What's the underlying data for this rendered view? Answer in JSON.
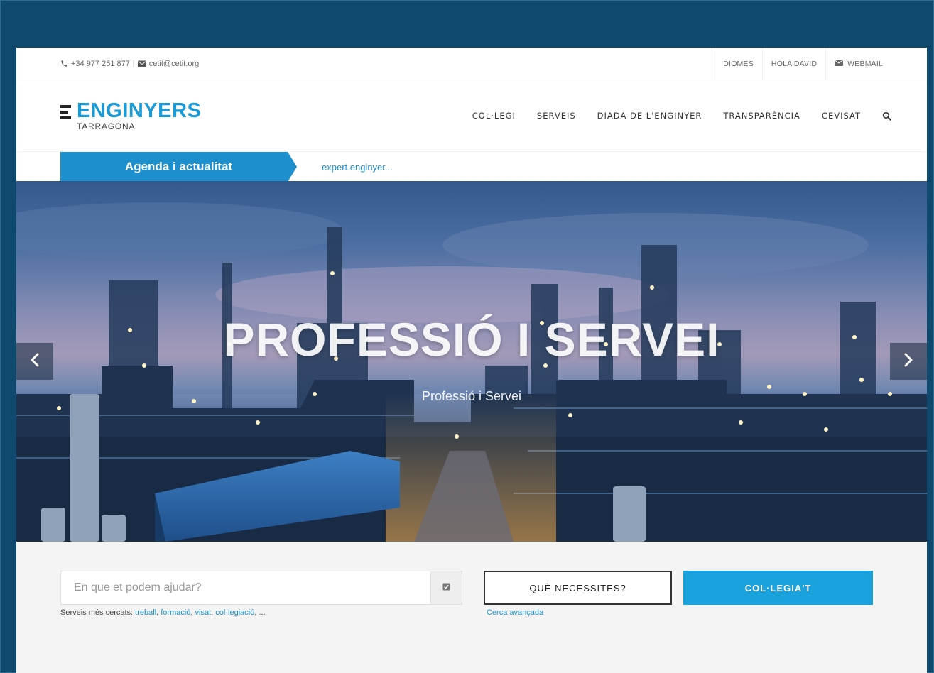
{
  "topbar": {
    "phone": "+34 977 251 877",
    "separator": "|",
    "email": "cetit@cetit.org",
    "utility_links": [
      "IDIOMES",
      "HOLA DAVID",
      "WEBMAIL"
    ]
  },
  "logo": {
    "name": "ENGINYERS",
    "sub": "TARRAGONA"
  },
  "nav": {
    "items": [
      "COL·LEGI",
      "SERVEIS",
      "DIADA DE L'ENGINYER",
      "TRANSPARÈNCIA",
      "CEVISAT"
    ]
  },
  "ribbon": {
    "tab_label": "Agenda i actualitat",
    "ticker_text": "expert.enginyer..."
  },
  "hero": {
    "title": "PROFESSIÓ I SERVEI",
    "subtitle": "Professió i Servei"
  },
  "search": {
    "placeholder": "En que et podem ajudar?",
    "popular_label": "Serveis més cercats: ",
    "popular_links": [
      "treball",
      "formació",
      "visat",
      "col·legiació",
      "..."
    ],
    "need_button": "QUÈ NECESSITES?",
    "advanced_link": "Cerca avançada",
    "join_button": "COL·LEGIA'T"
  },
  "colors": {
    "frame_background": "#0f4a6e",
    "brand_blue": "#1a9ad6",
    "ribbon_blue": "#1e8fcd",
    "join_button": "#1aa2de"
  },
  "icons": [
    "phone-icon",
    "envelope-icon",
    "mail-icon",
    "search-icon",
    "chevron-left-icon",
    "chevron-right-icon",
    "checkbox-icon"
  ]
}
